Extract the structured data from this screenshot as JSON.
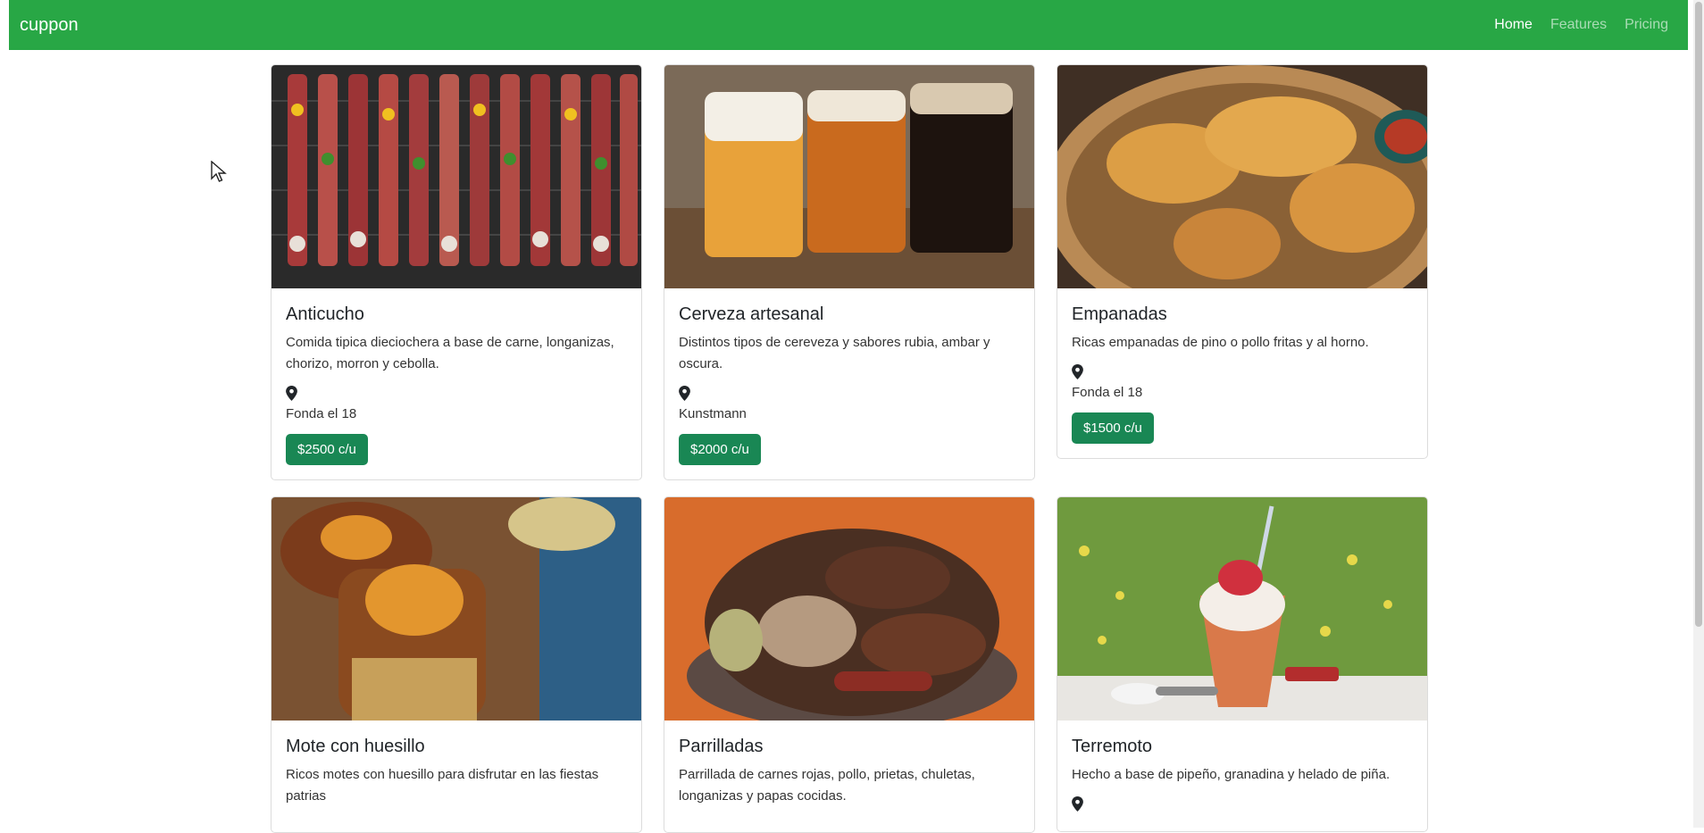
{
  "colors": {
    "brand": "#28a745",
    "button": "#198754"
  },
  "navbar": {
    "brand": "cuppon",
    "links": [
      {
        "label": "Home",
        "active": true
      },
      {
        "label": "Features",
        "active": false
      },
      {
        "label": "Pricing",
        "active": false
      }
    ]
  },
  "cards": [
    {
      "title": "Anticucho",
      "description": "Comida tipica dieciochera a base de carne, longanizas, chorizo, morron y cebolla.",
      "icon": "map-marker-icon",
      "place": "Fonda el 18",
      "price": "$2500 c/u"
    },
    {
      "title": "Cerveza artesanal",
      "description": "Distintos tipos de cereveza y sabores rubia, ambar y oscura.",
      "icon": "map-marker-icon",
      "place": "Kunstmann",
      "price": "$2000 c/u"
    },
    {
      "title": "Empanadas",
      "description": "Ricas empanadas de pino o pollo fritas y al horno.",
      "icon": "map-marker-icon",
      "place": "Fonda el 18",
      "price": "$1500 c/u"
    },
    {
      "title": "Mote con huesillo",
      "description": "Ricos motes con huesillo para disfrutar en las fiestas patrias",
      "icon": "map-marker-icon"
    },
    {
      "title": "Parrilladas",
      "description": "Parrillada de carnes rojas, pollo, prietas, chuletas, longanizas y papas cocidas.",
      "icon": "map-marker-icon"
    },
    {
      "title": "Terremoto",
      "description": "Hecho a base de pipeño, granadina y helado de piña.",
      "icon": "map-marker-icon"
    }
  ]
}
